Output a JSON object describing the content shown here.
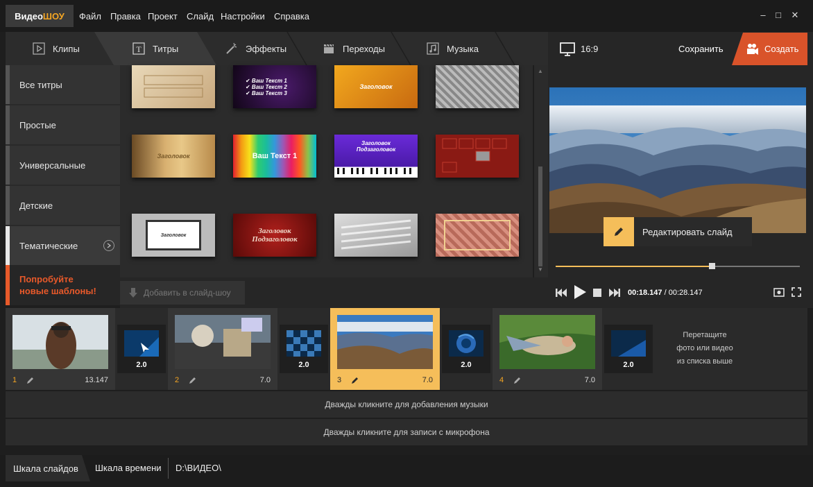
{
  "app": {
    "logo_a": "Видео",
    "logo_b": "ШОУ"
  },
  "menu": [
    "Файл",
    "Правка",
    "Проект",
    "Слайд",
    "Настройки",
    "Справка"
  ],
  "window": {
    "minimize": "–",
    "maximize": "□",
    "close": "✕"
  },
  "tabs": [
    {
      "label": "Клипы",
      "icon": "play-icon"
    },
    {
      "label": "Титры",
      "icon": "text-icon"
    },
    {
      "label": "Эффекты",
      "icon": "magic-wand-icon"
    },
    {
      "label": "Переходы",
      "icon": "clapper-icon"
    },
    {
      "label": "Музыка",
      "icon": "music-note-icon"
    }
  ],
  "active_tab": "Титры",
  "sidebar": {
    "items": [
      "Все титры",
      "Простые",
      "Универсальные",
      "Детские",
      "Тематические"
    ],
    "active": "Тематические",
    "promo": [
      "Попробуйте",
      "новые шаблоны!"
    ]
  },
  "thumbs": [
    {
      "lines": [
        "",
        "",
        ""
      ],
      "style": "paper"
    },
    {
      "lines": [
        "✔ Ваш Текст 1",
        "✔ Ваш Текст 2",
        "✔ Ваш Текст 3"
      ],
      "style": "purple"
    },
    {
      "lines": [
        "Заголовок",
        "",
        ""
      ],
      "style": "orange"
    },
    {
      "lines": [
        "",
        "",
        ""
      ],
      "style": "metal"
    },
    {
      "lines": [
        "Заголовок",
        "",
        ""
      ],
      "style": "book"
    },
    {
      "lines": [
        "Ваш Текст 1",
        "",
        ""
      ],
      "style": "rainbow"
    },
    {
      "lines": [
        "Заголовок",
        "Подзаголовок",
        ""
      ],
      "style": "piano"
    },
    {
      "lines": [
        "",
        "",
        ""
      ],
      "style": "redtiles"
    },
    {
      "lines": [
        "Заголовок",
        "",
        ""
      ],
      "style": "screen"
    },
    {
      "lines": [
        "Заголовок",
        "Подзаголовок",
        ""
      ],
      "style": "velvet"
    },
    {
      "lines": [
        "",
        "",
        ""
      ],
      "style": "silver"
    },
    {
      "lines": [
        "",
        "",
        ""
      ],
      "style": "pattern"
    }
  ],
  "add_button": "Добавить в слайд-шоу",
  "preview": {
    "aspect": "16:9",
    "save": "Сохранить",
    "create": "Создать",
    "edit_slide": "Редактировать слайд",
    "time_current": "00:18.147",
    "time_separator": " / ",
    "time_total": "00:28.147",
    "progress": 0.64
  },
  "slides": [
    {
      "num": "1",
      "duration": "13.147",
      "transition": "2.0"
    },
    {
      "num": "2",
      "duration": "7.0",
      "transition": "2.0"
    },
    {
      "num": "3",
      "duration": "7.0",
      "transition": "2.0",
      "selected": true
    },
    {
      "num": "4",
      "duration": "7.0",
      "transition": "2.0"
    }
  ],
  "drop_hint": [
    "Перетащите",
    "фото или видео",
    "из списка выше"
  ],
  "music_row": "Дважды кликните для добавления музыки",
  "mic_row": "Дважды кликните для записи с микрофона",
  "bottom": {
    "slides_tab": "Шкала слайдов",
    "time_tab": "Шкала времени",
    "path": "D:\\ВИДЕО\\"
  },
  "colors": {
    "accent": "#f5be5a",
    "create": "#d9532a",
    "promo": "#e8592a"
  }
}
